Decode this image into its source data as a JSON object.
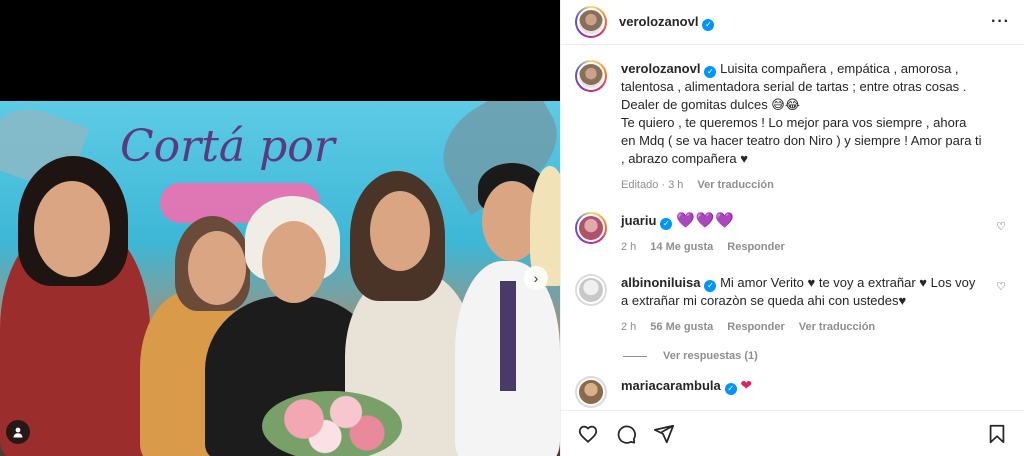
{
  "post": {
    "author": "verolozanovl",
    "caption": "Luisita compañera , empática , amorosa , talentosa , alimentadora serial de tartas ; entre otras cosas . Dealer de gomitas dulces 😅😂",
    "caption_2": "Te quiero , te queremos ! Lo mejor para vos siempre , ahora en Mdq ( se va hacer teatro don Niro ) y siempre ! Amor para ti , abrazo compañera ♥",
    "edited": "Editado · 3 h",
    "translate": "Ver traducción"
  },
  "media": {
    "banner_text": "Cortá por"
  },
  "comments": [
    {
      "user": "juariu",
      "text": "💜💜💜",
      "time": "2 h",
      "likes": "14 Me gusta",
      "reply": "Responder"
    },
    {
      "user": "albinoniluisa",
      "text": "Mi amor Verito ♥ te voy a extrañar ♥ Los voy a extrañar mi corazòn se queda ahi con ustedes♥",
      "time": "2 h",
      "likes": "56 Me gusta",
      "reply": "Responder",
      "translate": "Ver traducción",
      "view_replies": "Ver respuestas (1)"
    },
    {
      "user": "mariacarambula",
      "text": "❤"
    }
  ],
  "icons": [
    "heart-icon",
    "comment-icon",
    "share-icon",
    "bookmark-icon",
    "more-icon",
    "verified-icon",
    "tag-icon",
    "next-icon"
  ]
}
